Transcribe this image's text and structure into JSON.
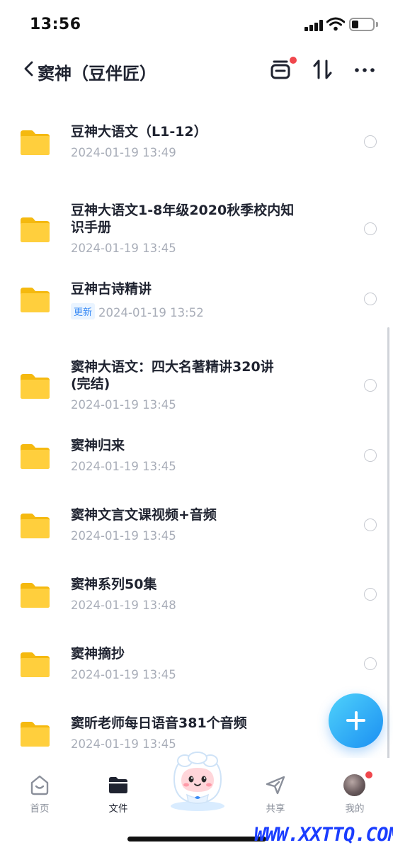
{
  "status_bar": {
    "time": "13:56"
  },
  "header": {
    "title": "窦神（豆伴匠）"
  },
  "files": [
    {
      "title_lines": [
        "豆神大语文（L1-12）"
      ],
      "date": "2024-01-19 13:49",
      "badge": ""
    },
    {
      "title_lines": [
        "豆神大语文1-8年级2020秋季校内知",
        "识手册"
      ],
      "date": "2024-01-19 13:45",
      "badge": ""
    },
    {
      "title_lines": [
        "豆神古诗精讲"
      ],
      "date": "2024-01-19 13:52",
      "badge": "更新"
    },
    {
      "title_lines": [
        "窦神大语文：四大名著精讲320讲",
        "(完结)"
      ],
      "date": "2024-01-19 13:45",
      "badge": ""
    },
    {
      "title_lines": [
        "窦神归来"
      ],
      "date": "2024-01-19 13:45",
      "badge": ""
    },
    {
      "title_lines": [
        "窦神文言文课视频+音频"
      ],
      "date": "2024-01-19 13:45",
      "badge": ""
    },
    {
      "title_lines": [
        "窦神系列50集"
      ],
      "date": "2024-01-19 13:48",
      "badge": ""
    },
    {
      "title_lines": [
        "窦神摘抄"
      ],
      "date": "2024-01-19 13:45",
      "badge": ""
    },
    {
      "title_lines": [
        "窦昕老师每日语音381个音频"
      ],
      "date": "2024-01-19 13:45",
      "badge": ""
    }
  ],
  "tabs": [
    {
      "label": "首页",
      "icon": "home-icon"
    },
    {
      "label": "文件",
      "icon": "folder-icon"
    },
    {
      "label": "共享",
      "icon": "send-icon"
    },
    {
      "label": "我的",
      "icon": "avatar"
    }
  ],
  "watermark": "WWW.XXTTQ.COM",
  "colors": {
    "accent": "#3a8bf5",
    "folder": "#ffcf3d",
    "badge_bg": "#eaf4ff",
    "notification": "#f0474d"
  }
}
